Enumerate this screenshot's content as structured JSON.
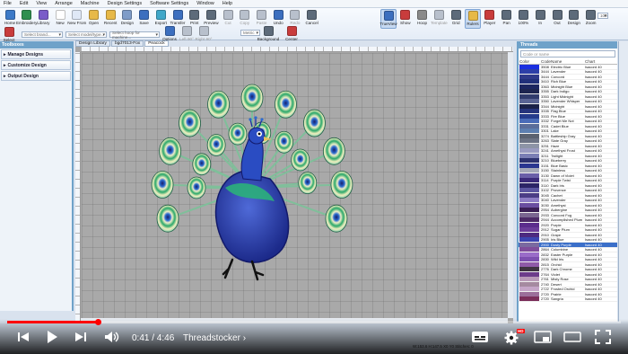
{
  "menu": [
    "File",
    "Edit",
    "View",
    "Arrange",
    "Machine",
    "Design Settings",
    "Software Settings",
    "Window",
    "Help"
  ],
  "ribbon": {
    "left": [
      {
        "label": "Home",
        "icon": "home-icon",
        "color": "#3c7ac8"
      },
      {
        "label": "Embroidery",
        "icon": "embroidery-icon",
        "color": "#2f8f4f"
      },
      {
        "label": "Library",
        "icon": "library-icon",
        "color": "#7a5cc8"
      },
      {
        "label": "New",
        "icon": "new-file-icon",
        "color": "#ffffff"
      },
      {
        "label": "New From",
        "icon": "new-from-icon",
        "color": "#dfe8f6"
      },
      {
        "label": "Open",
        "icon": "open-folder-icon",
        "color": "#e7b948"
      },
      {
        "label": "Recent",
        "icon": "recent-icon",
        "color": "#e7b948"
      },
      {
        "label": "Design",
        "icon": "design-icon",
        "color": "#7e9cc8"
      },
      {
        "label": "Save",
        "icon": "save-icon",
        "color": "#3c6fbf"
      },
      {
        "label": "Export",
        "icon": "export-icon",
        "color": "#3fa7c9"
      },
      {
        "label": "Transfer",
        "icon": "transfer-icon",
        "color": "#3c6fbf"
      },
      {
        "label": "Print",
        "icon": "print-icon",
        "color": "#5d6b7a"
      },
      {
        "label": "Preview",
        "icon": "preview-icon",
        "color": "#5d6b7a"
      },
      {
        "label": "Cut",
        "icon": "cut-icon",
        "color": "#b8c0cc",
        "dim": true
      },
      {
        "label": "Copy",
        "icon": "copy-icon",
        "color": "#b8c0cc",
        "dim": true
      },
      {
        "label": "Paste",
        "icon": "paste-icon",
        "color": "#b8c0cc",
        "dim": true
      },
      {
        "label": "Undo",
        "icon": "undo-icon",
        "color": "#3c6fbf"
      },
      {
        "label": "Redo",
        "icon": "redo-icon",
        "color": "#b8c0cc",
        "dim": true
      },
      {
        "label": "Cancel",
        "icon": "cancel-icon",
        "color": "#5d6b7a"
      }
    ],
    "right": [
      {
        "label": "TrueView",
        "icon": "trueview-icon",
        "color": "#3c6fbf",
        "active": true
      },
      {
        "label": "Show",
        "icon": "show-icon",
        "color": "#c83c3c"
      },
      {
        "label": "Hoop",
        "icon": "hoop-icon",
        "color": "#8a8a8a"
      },
      {
        "label": "Template",
        "icon": "template-icon",
        "color": "#b8c0cc",
        "dim": true
      },
      {
        "label": "Grid",
        "icon": "grid-icon",
        "color": "#5d6b7a"
      },
      {
        "label": "Rulers",
        "icon": "rulers-icon",
        "color": "#e7b948",
        "active": true
      },
      {
        "label": "Player",
        "icon": "player-icon",
        "color": "#c83c3c"
      },
      {
        "label": "Pan",
        "icon": "pan-hand-icon",
        "color": "#5d6b7a"
      },
      {
        "label": "100%",
        "icon": "zoom-100-icon",
        "color": "#5d6b7a"
      },
      {
        "label": "In",
        "icon": "zoom-in-icon",
        "color": "#5d6b7a"
      },
      {
        "label": "Out",
        "icon": "zoom-out-icon",
        "color": "#5d6b7a"
      },
      {
        "label": "Design",
        "icon": "zoom-design-icon",
        "color": "#5d6b7a"
      },
      {
        "label": "Zoom",
        "icon": "zoom-box-icon",
        "color": "#5d6b7a"
      }
    ],
    "zoom_value": "100",
    "row2_buttons": [
      {
        "label": "Select",
        "icon": "select-arrow-icon",
        "color": "#c83c3c"
      },
      {
        "label": "Options",
        "icon": "options-icon",
        "color": "#3c6fbf"
      },
      {
        "label": "Left 90°",
        "icon": "rotate-left-icon",
        "color": "#b8c0cc",
        "dim": true
      },
      {
        "label": "Right 90°",
        "icon": "rotate-right-icon",
        "color": "#b8c0cc",
        "dim": true
      },
      {
        "label": "Background",
        "icon": "background-icon",
        "color": "#5d6b7a"
      },
      {
        "label": "Center",
        "icon": "center-icon",
        "color": "#c83c3c"
      }
    ],
    "brand_placeholder": "Select brand...",
    "model_placeholder": "Select model/type...",
    "hoop_placeholder": "Select hoop for machine...",
    "units": "Metric"
  },
  "toolbox": {
    "title": "Toolboxes",
    "items": [
      "Manage Designs",
      "Customize Design",
      "Output Design"
    ]
  },
  "doctabs": [
    "Design Library",
    "bgd7013-Fox",
    "Peacock"
  ],
  "threads": {
    "title": "Threads",
    "search_placeholder": "Code or name",
    "headers": [
      "Color",
      "Code",
      "Name",
      "Chart"
    ],
    "rows": [
      {
        "code": "3508",
        "name": "Electric Blue",
        "chart": "Isacord 40",
        "color": "#1b2fe0"
      },
      {
        "code": "3444",
        "name": "Lavender",
        "chart": "Isacord 40",
        "color": "#2d3fa8"
      },
      {
        "code": "3444",
        "name": "Concord",
        "chart": "Isacord 40",
        "color": "#2f3a8a"
      },
      {
        "code": "3410",
        "name": "Rich Blue",
        "chart": "Isacord 40",
        "color": "#21307a"
      },
      {
        "code": "3363",
        "name": "Midnight Blue",
        "chart": "Isacord 40",
        "color": "#1c2660"
      },
      {
        "code": "3355",
        "name": "Dark Indigo",
        "chart": "Isacord 40",
        "color": "#1d2550"
      },
      {
        "code": "3353",
        "name": "Light Midnight",
        "chart": "Isacord 40",
        "color": "#303b6c"
      },
      {
        "code": "3350",
        "name": "Lavender Whisper",
        "chart": "Isacord 40",
        "color": "#5a6494"
      },
      {
        "code": "3344",
        "name": "Midnight",
        "chart": "Isacord 40",
        "color": "#1a2148"
      },
      {
        "code": "3335",
        "name": "Flag Blue",
        "chart": "Isacord 40",
        "color": "#26347c"
      },
      {
        "code": "3333",
        "name": "Fire Blue",
        "chart": "Isacord 40",
        "color": "#253b8c"
      },
      {
        "code": "3332",
        "name": "Forget Me Not",
        "chart": "Isacord 40",
        "color": "#4a6cb8"
      },
      {
        "code": "3331",
        "name": "Cadet Blue",
        "chart": "Isacord 40",
        "color": "#5a6d9a"
      },
      {
        "code": "3301",
        "name": "Lake",
        "chart": "Isacord 40",
        "color": "#5d7fb0"
      },
      {
        "code": "3274",
        "name": "Battleship Gray",
        "chart": "Isacord 40",
        "color": "#5b6270"
      },
      {
        "code": "3263",
        "name": "Slate Gray",
        "chart": "Isacord 40",
        "color": "#6c7384"
      },
      {
        "code": "3251",
        "name": "Haze",
        "chart": "Isacord 40",
        "color": "#8d94a6"
      },
      {
        "code": "3241",
        "name": "Amethyst Frost",
        "chart": "Isacord 40",
        "color": "#9a9bc0"
      },
      {
        "code": "3211",
        "name": "Twilight",
        "chart": "Isacord 40",
        "color": "#7b7fb4"
      },
      {
        "code": "3210",
        "name": "Blueberry",
        "chart": "Isacord 40",
        "color": "#2e3370"
      },
      {
        "code": "3151",
        "name": "Blue Basic",
        "chart": "Isacord 40",
        "color": "#2a3690"
      },
      {
        "code": "3150",
        "name": "Stainless",
        "chart": "Isacord 40",
        "color": "#a5a9b8"
      },
      {
        "code": "3130",
        "name": "Dawn of Violet",
        "chart": "Isacord 40",
        "color": "#6a5fa8"
      },
      {
        "code": "3114",
        "name": "Purple Twist",
        "chart": "Isacord 40",
        "color": "#3b2a7a"
      },
      {
        "code": "3110",
        "name": "Dark Iris",
        "chart": "Isacord 40",
        "color": "#2c2466"
      },
      {
        "code": "3102",
        "name": "Provence",
        "chart": "Isacord 40",
        "color": "#5b55a0"
      },
      {
        "code": "3045",
        "name": "Cachet",
        "chart": "Isacord 40",
        "color": "#4b3d86"
      },
      {
        "code": "3040",
        "name": "Lavender",
        "chart": "Isacord 40",
        "color": "#8d7dc4"
      },
      {
        "code": "3030",
        "name": "Amethyst",
        "chart": "Isacord 40",
        "color": "#6a4fa0"
      },
      {
        "code": "2954",
        "name": "Aubergine",
        "chart": "Isacord 40",
        "color": "#3a1f55"
      },
      {
        "code": "2933",
        "name": "Concord Fog",
        "chart": "Isacord 40",
        "color": "#7a6690"
      },
      {
        "code": "2944",
        "name": "Accomplished Plum",
        "chart": "Isacord 40",
        "color": "#4c2a66"
      },
      {
        "code": "2920",
        "name": "Purple",
        "chart": "Isacord 40",
        "color": "#5b2d8c"
      },
      {
        "code": "2912",
        "name": "Sugar Plum",
        "chart": "Isacord 40",
        "color": "#6b3d9a"
      },
      {
        "code": "2910",
        "name": "Grape",
        "chart": "Isacord 40",
        "color": "#4d2a80"
      },
      {
        "code": "2905",
        "name": "Iris Blue",
        "chart": "Isacord 40",
        "color": "#3c44b0"
      },
      {
        "code": "2900",
        "name": "Dusty Purple",
        "chart": "Isacord 40",
        "color": "#7a6aa0",
        "selected": true
      },
      {
        "code": "2864",
        "name": "Columbine",
        "chart": "Isacord 40",
        "color": "#7f4c9a"
      },
      {
        "code": "2832",
        "name": "Easter Purple",
        "chart": "Isacord 40",
        "color": "#9a6cc8"
      },
      {
        "code": "2830",
        "name": "Wild Iris",
        "chart": "Isacord 40",
        "color": "#7d4fb0"
      },
      {
        "code": "2815",
        "name": "Orchid",
        "chart": "Isacord 40",
        "color": "#8f5aa8"
      },
      {
        "code": "2776",
        "name": "Dark Chrome",
        "chart": "Isacord 40",
        "color": "#3e3340"
      },
      {
        "code": "2764",
        "name": "Violet",
        "chart": "Isacord 40",
        "color": "#6c3c8a"
      },
      {
        "code": "2761",
        "name": "Misty Rose",
        "chart": "Isacord 40",
        "color": "#b99ab8"
      },
      {
        "code": "2740",
        "name": "Desert",
        "chart": "Isacord 40",
        "color": "#a58aa0"
      },
      {
        "code": "2722",
        "name": "Frosted Orchid",
        "chart": "Isacord 40",
        "color": "#c5a6c8"
      },
      {
        "code": "2720",
        "name": "Prairie",
        "chart": "Isacord 40",
        "color": "#9b6e9a"
      },
      {
        "code": "2720",
        "name": "Sangria",
        "chart": "Isacord 40",
        "color": "#7a2e5a"
      }
    ]
  },
  "status": {
    "text": "W:153.6  H:147.5    X0  Y0   Stitches: 0"
  },
  "video": {
    "progress": 0.148,
    "time": "0:41 / 4:46",
    "chapter": "Threadstocker",
    "hd": "HD",
    "chapter_arrow": "›"
  },
  "colors": {
    "accent": "#6fa2c9",
    "progress": "#ff0000"
  }
}
